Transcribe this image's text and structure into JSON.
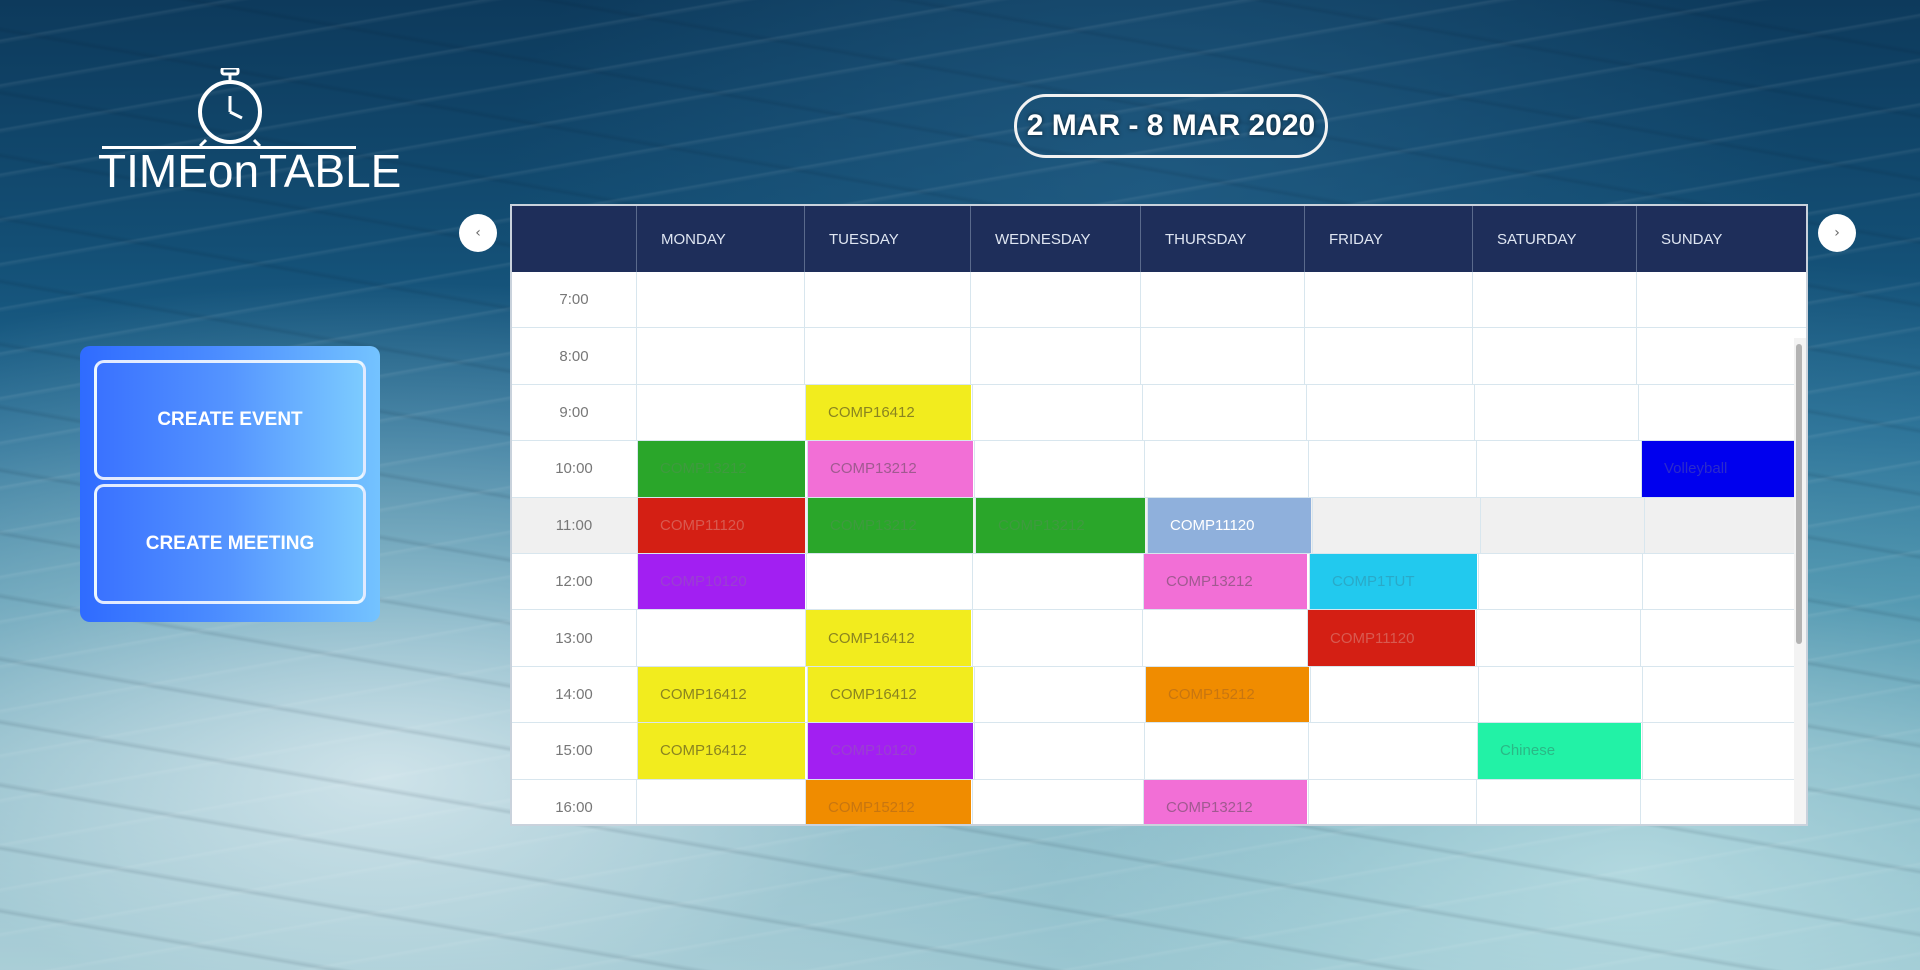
{
  "app": {
    "logo_text": "TIMEonTABLE"
  },
  "header": {
    "date_range": "2 MAR - 8 MAR 2020",
    "prev_label": "‹",
    "next_label": "›"
  },
  "actions": {
    "create_event": "CREATE EVENT",
    "create_meeting": "CREATE MEETING"
  },
  "calendar": {
    "days": [
      "MONDAY",
      "TUESDAY",
      "WEDNESDAY",
      "THURSDAY",
      "FRIDAY",
      "SATURDAY",
      "SUNDAY"
    ],
    "highlight_row": "11:00",
    "rows": [
      {
        "time": "7:00",
        "cells": [
          null,
          null,
          null,
          null,
          null,
          null,
          null
        ]
      },
      {
        "time": "8:00",
        "cells": [
          null,
          null,
          null,
          null,
          null,
          null,
          null
        ]
      },
      {
        "time": "9:00",
        "cells": [
          null,
          {
            "label": "COMP16412",
            "color": "#f2ec1e",
            "text": "#8a8420"
          },
          null,
          null,
          null,
          null,
          null
        ]
      },
      {
        "time": "10:00",
        "cells": [
          {
            "label": "COMP13212",
            "color": "#2aa62a",
            "text": "#3f9a3f"
          },
          {
            "label": "COMP13212",
            "color": "#f26fd6",
            "text": "#a05a90"
          },
          null,
          null,
          null,
          null,
          {
            "label": "Volleyball",
            "color": "#0000ee",
            "text": "#2a2acc"
          }
        ]
      },
      {
        "time": "11:00",
        "cells": [
          {
            "label": "COMP11120",
            "color": "#d41f14",
            "text": "#d85a50"
          },
          {
            "label": "COMP13212",
            "color": "#2aa62a",
            "text": "#3f9a3f"
          },
          {
            "label": "COMP13212",
            "color": "#2aa62a",
            "text": "#3f9a3f"
          },
          {
            "label": "COMP11120",
            "color": "#8fb0dc",
            "text": "#ffffff"
          },
          null,
          null,
          null
        ]
      },
      {
        "time": "12:00",
        "cells": [
          {
            "label": "COMP10120",
            "color": "#a21ff2",
            "text": "#9a40d0"
          },
          null,
          null,
          {
            "label": "COMP13212",
            "color": "#f26fd6",
            "text": "#a05a90"
          },
          {
            "label": "COMP1TUT",
            "color": "#22c9ee",
            "text": "#2aa9c8"
          },
          null,
          null
        ]
      },
      {
        "time": "13:00",
        "cells": [
          null,
          {
            "label": "COMP16412",
            "color": "#f2ec1e",
            "text": "#8a8420"
          },
          null,
          null,
          {
            "label": "COMP11120",
            "color": "#d41f14",
            "text": "#d85a50"
          },
          null,
          null
        ]
      },
      {
        "time": "14:00",
        "cells": [
          {
            "label": "COMP16412",
            "color": "#f2ec1e",
            "text": "#8a8420"
          },
          {
            "label": "COMP16412",
            "color": "#f2ec1e",
            "text": "#8a8420"
          },
          null,
          {
            "label": "COMP15212",
            "color": "#f08c00",
            "text": "#c87610"
          },
          null,
          null,
          null
        ]
      },
      {
        "time": "15:00",
        "cells": [
          {
            "label": "COMP16412",
            "color": "#f2ec1e",
            "text": "#8a8420"
          },
          {
            "label": "COMP10120",
            "color": "#a21ff2",
            "text": "#9a40d0"
          },
          null,
          null,
          null,
          {
            "label": "Chinese",
            "color": "#22f2a6",
            "text": "#2ab886"
          },
          null
        ]
      },
      {
        "time": "16:00",
        "cells": [
          null,
          {
            "label": "COMP15212",
            "color": "#f08c00",
            "text": "#c87610"
          },
          null,
          {
            "label": "COMP13212",
            "color": "#f26fd6",
            "text": "#a05a90"
          },
          null,
          null,
          null
        ]
      }
    ]
  }
}
